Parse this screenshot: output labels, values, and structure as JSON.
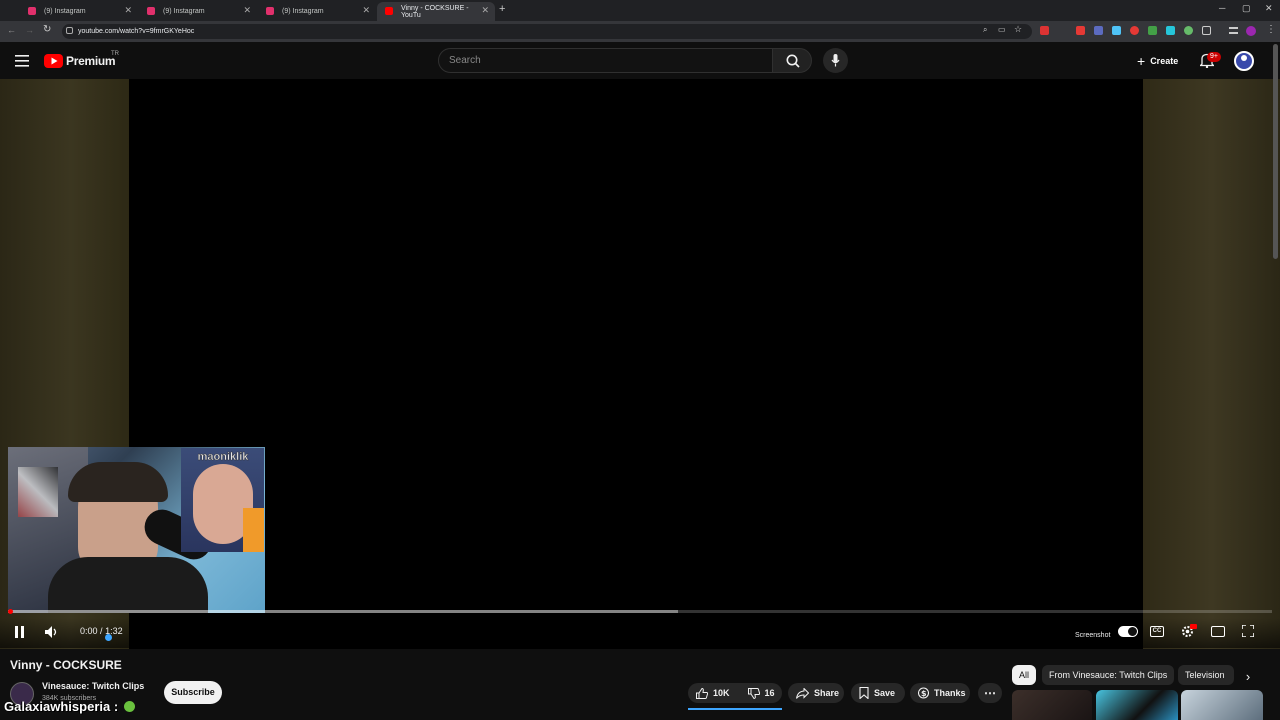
{
  "browser": {
    "tabs": [
      {
        "title": "(9) Instagram",
        "active": false
      },
      {
        "title": "(9) Instagram",
        "active": false
      },
      {
        "title": "(9) Instagram",
        "active": false
      },
      {
        "title": "Vinny - COCKSURE - YouTu",
        "active": true
      }
    ],
    "url": "youtube.com/watch?v=9fmrGKYeHoc",
    "new_tab": "+"
  },
  "header": {
    "logo_text": "Premium",
    "region": "TR",
    "search_placeholder": "Search",
    "create_label": "Create",
    "notifications_badge": "9+"
  },
  "player": {
    "current_time": "0:00",
    "duration": "1:32",
    "time_separator": "/",
    "buffered_fraction": 0.53,
    "screenshot_label": "Screenshot",
    "webcam_overlay_text": "maoniklik"
  },
  "video": {
    "title": "Vinny - COCKSURE",
    "channel": "Vinesauce: Twitch Clips",
    "subscribers": "384K subscribers",
    "subscribe_label": "Subscribe",
    "likes": "10K",
    "dislikes": "16",
    "share_label": "Share",
    "save_label": "Save",
    "thanks_label": "Thanks"
  },
  "chips": [
    "All",
    "From Vinesauce: Twitch Clips",
    "Television"
  ],
  "overlay_chat": "Galaxiawhisperia :",
  "colors": {
    "yt_red": "#ff0000",
    "page_bg": "#0f0f0f",
    "accent_blue": "#3ea6ff",
    "instagram_pink": "#e1306c"
  }
}
